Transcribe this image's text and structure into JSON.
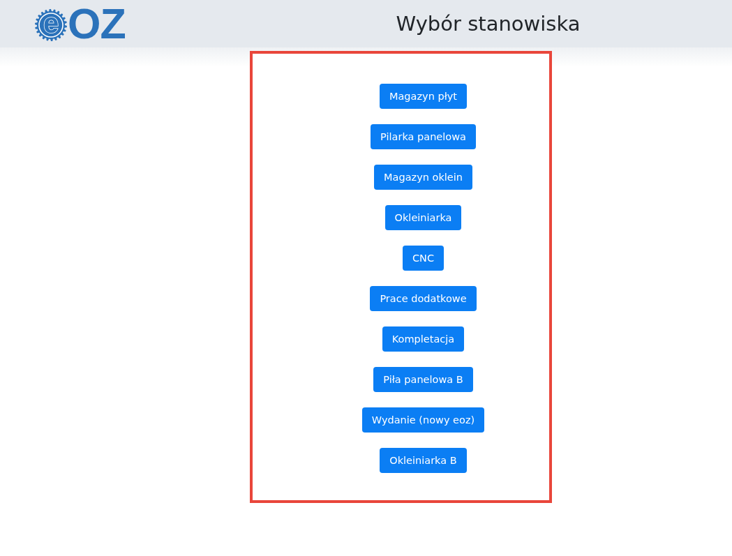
{
  "header": {
    "logo": {
      "mark": "e",
      "text": "OZ"
    },
    "title": "Wybór stanowiska"
  },
  "stations": [
    "Magazyn płyt",
    "Pilarka panelowa",
    "Magazyn oklein",
    "Okleiniarka",
    "CNC",
    "Prace dodatkowe",
    "Kompletacja",
    "Piła panelowa B",
    "Wydanie (nowy eoz)",
    "Okleiniarka B"
  ]
}
